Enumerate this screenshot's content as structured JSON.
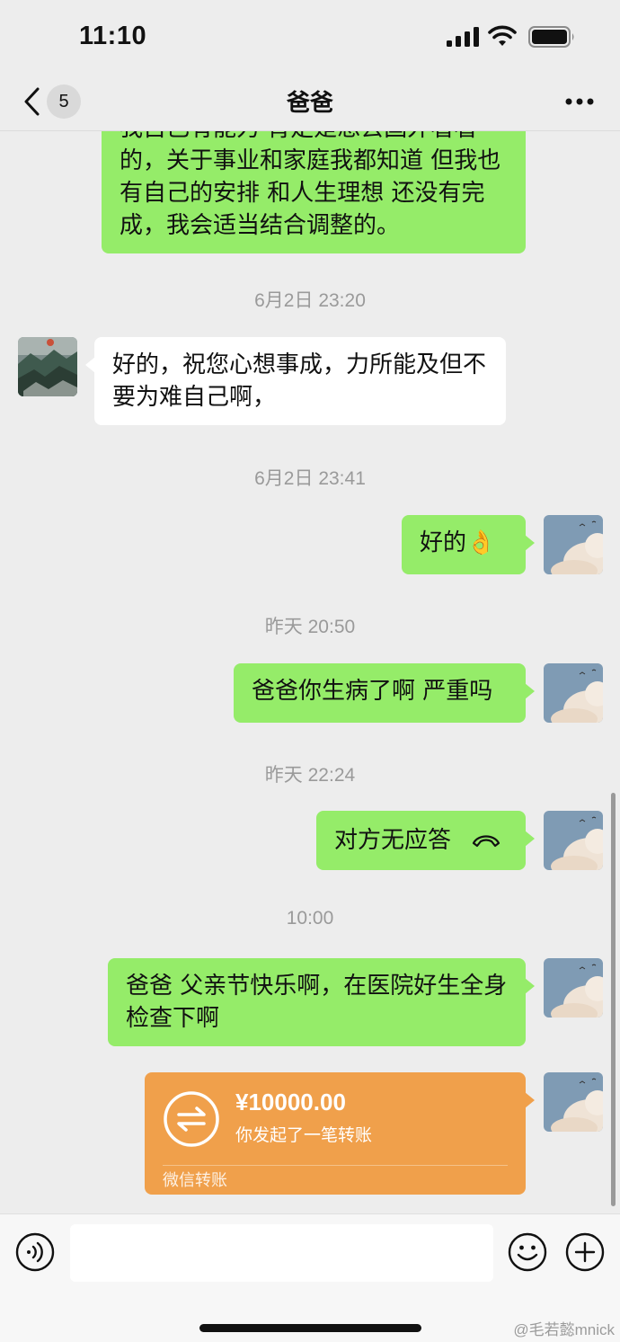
{
  "status_bar": {
    "time": "11:10"
  },
  "nav": {
    "title": "爸爸",
    "unread_count": "5"
  },
  "messages": {
    "m1": "我自己有能力 肯定是想去国外看看的，关于事业和家庭我都知道 但我也有自己的安排 和人生理想 还没有完成，我会适当结合调整的。",
    "t1": "6月2日 23:20",
    "m2": "好的，祝您心想事成，力所能及但不要为难自己啊，",
    "t2": "6月2日 23:41",
    "m3": "好的👌",
    "t3": "昨天 20:50",
    "m4": "爸爸你生病了啊 严重吗",
    "t4": "昨天 22:24",
    "m5": "对方无应答",
    "t5": "10:00",
    "m6": "爸爸 父亲节快乐啊，在医院好生全身检查下啊"
  },
  "transfer": {
    "amount": "¥10000.00",
    "description": "你发起了一笔转账",
    "footer": "微信转账"
  },
  "input": {
    "value": ""
  },
  "watermark": "@毛若懿mnick",
  "colors": {
    "background": "#ededed",
    "sent_bubble": "#95ec69",
    "received_bubble": "#ffffff",
    "transfer_card": "#f0a04b"
  }
}
